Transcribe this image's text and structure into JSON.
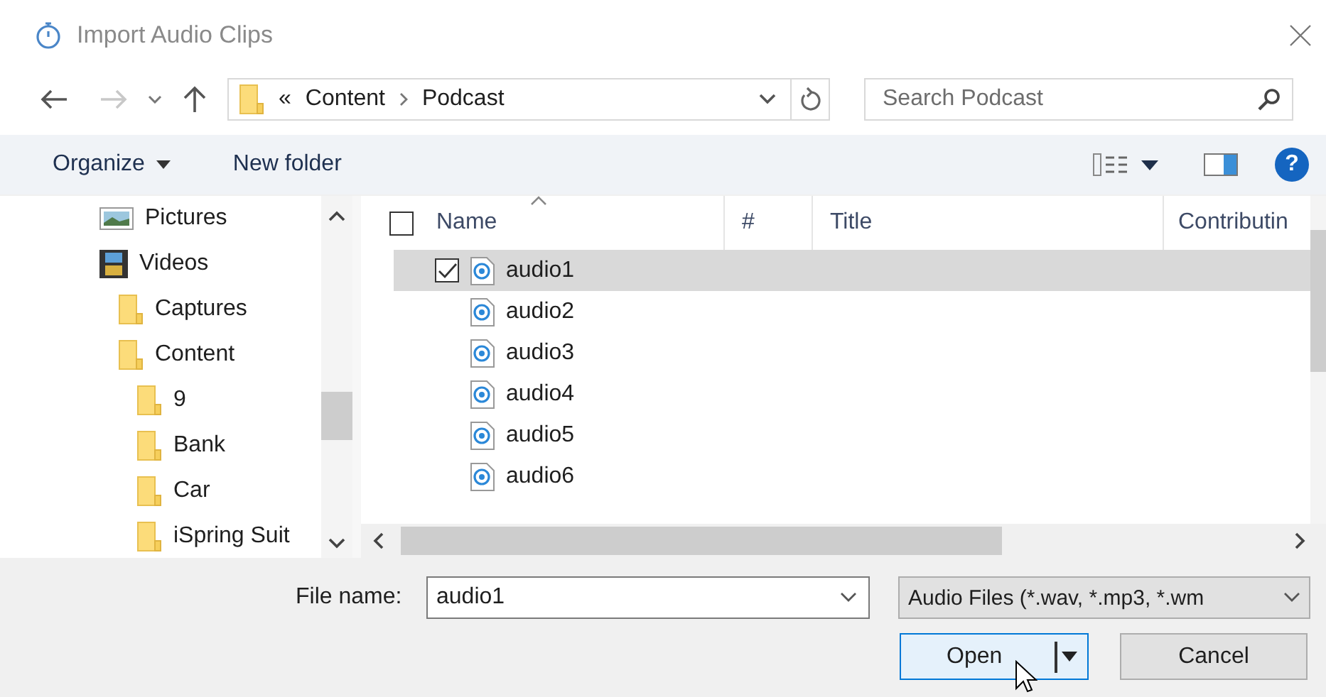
{
  "window": {
    "title": "Import Audio Clips"
  },
  "address": {
    "overflow": "«",
    "path": [
      "Content",
      "Podcast"
    ]
  },
  "search": {
    "placeholder": "Search Podcast"
  },
  "toolbar": {
    "organize": "Organize",
    "new_folder": "New folder",
    "help": "?"
  },
  "nav_tree": [
    {
      "label": "Pictures",
      "kind": "pictures"
    },
    {
      "label": "Videos",
      "kind": "videos",
      "children": [
        {
          "label": "Captures",
          "kind": "folder"
        },
        {
          "label": "Content",
          "kind": "folder",
          "children": [
            {
              "label": "9",
              "kind": "folder"
            },
            {
              "label": "Bank",
              "kind": "folder"
            },
            {
              "label": "Car",
              "kind": "folder"
            },
            {
              "label": "iSpring Suit",
              "kind": "folder"
            }
          ]
        }
      ]
    }
  ],
  "file_list": {
    "select_all_checked": false,
    "columns": [
      "Name",
      "#",
      "Title",
      "Contributin"
    ],
    "rows": [
      {
        "name": "audio1",
        "selected": true,
        "checked": true
      },
      {
        "name": "audio2",
        "selected": false,
        "checked": false
      },
      {
        "name": "audio3",
        "selected": false,
        "checked": false
      },
      {
        "name": "audio4",
        "selected": false,
        "checked": false
      },
      {
        "name": "audio5",
        "selected": false,
        "checked": false
      },
      {
        "name": "audio6",
        "selected": false,
        "checked": false
      }
    ]
  },
  "file_name": {
    "label": "File name:",
    "value": "audio1"
  },
  "file_type": {
    "value": "Audio Files (*.wav, *.mp3, *.wm"
  },
  "buttons": {
    "open": "Open",
    "cancel": "Cancel"
  }
}
